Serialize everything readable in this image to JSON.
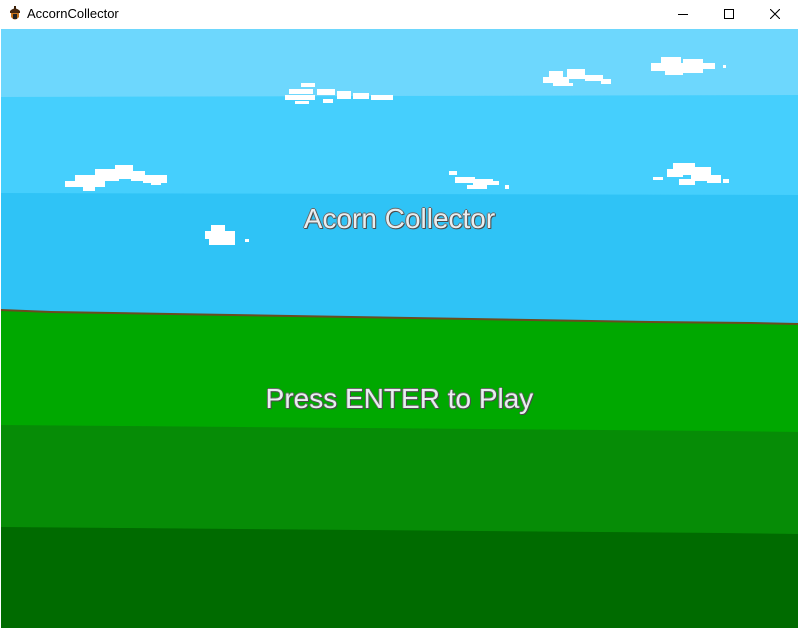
{
  "window": {
    "title": "AccornCollector",
    "minimize_icon": "minimize-icon",
    "maximize_icon": "maximize-icon",
    "close_icon": "close-icon"
  },
  "game": {
    "title": "Acorn Collector",
    "prompt": "Press ENTER to Play"
  },
  "colors": {
    "sky_top": "#6dd7fd",
    "sky_mid": "#45cffd",
    "sky_low": "#2fc3f6",
    "grass_1": "#00a800",
    "grass_2": "#068c06",
    "grass_3": "#006b00",
    "cloud": "#ffffff"
  }
}
